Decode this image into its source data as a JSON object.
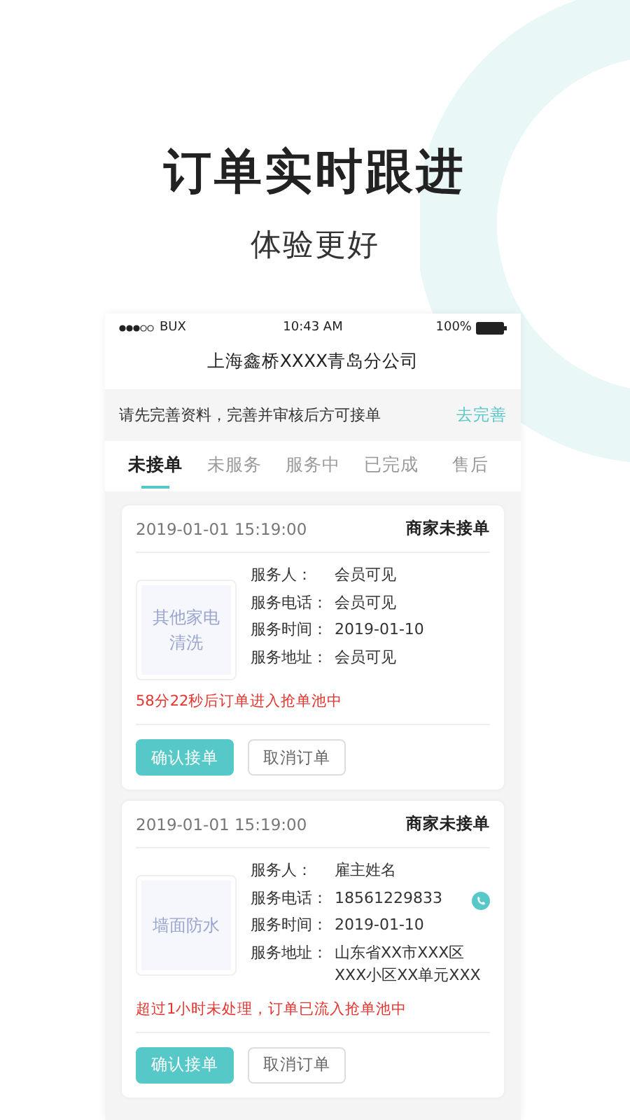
{
  "headline": "订单实时跟进",
  "subheadline": "体验更好",
  "phone": {
    "status_bar": {
      "carrier": "BUX",
      "time": "10:43 AM",
      "battery": "100%"
    },
    "title": "上海鑫桥XXXX青岛分公司"
  },
  "notice": {
    "text": "请先完善资料，完善并审核后方可接单",
    "link": "去完善"
  },
  "tabs": [
    {
      "label": "未接单",
      "selected": true
    },
    {
      "label": "未服务",
      "selected": false
    },
    {
      "label": "服务中",
      "selected": false
    },
    {
      "label": "已完成",
      "selected": false
    },
    {
      "label": "售后",
      "selected": false
    }
  ],
  "orders": [
    {
      "time": "2019-01-01 15:19:00",
      "status": "商家未接单",
      "category": "其他家电清洗",
      "fields": [
        {
          "label": "服务人：",
          "value": "会员可见",
          "call": false
        },
        {
          "label": "服务电话：",
          "value": "会员可见",
          "call": false
        },
        {
          "label": "服务时间：",
          "value": "2019-01-10",
          "call": false
        },
        {
          "label": "服务地址：",
          "value": "会员可见",
          "call": false
        }
      ],
      "warning": "58分22秒后订单进入抢单池中",
      "buttons": [
        "确认接单",
        "取消订单"
      ]
    },
    {
      "time": "2019-01-01 15:19:00",
      "status": "商家未接单",
      "category": "墙面防水",
      "fields": [
        {
          "label": "服务人：",
          "value": "雇主姓名",
          "call": false
        },
        {
          "label": "服务电话：",
          "value": "18561229833",
          "call": true
        },
        {
          "label": "服务时间：",
          "value": "2019-01-10",
          "call": false
        },
        {
          "label": "服务地址：",
          "value": "山东省XX市XXX区XXX小区XX单元XXX",
          "call": false
        }
      ],
      "warning": "超过1小时未处理，订单已流入抢单池中",
      "buttons": [
        "确认接单",
        "取消订单"
      ]
    }
  ]
}
